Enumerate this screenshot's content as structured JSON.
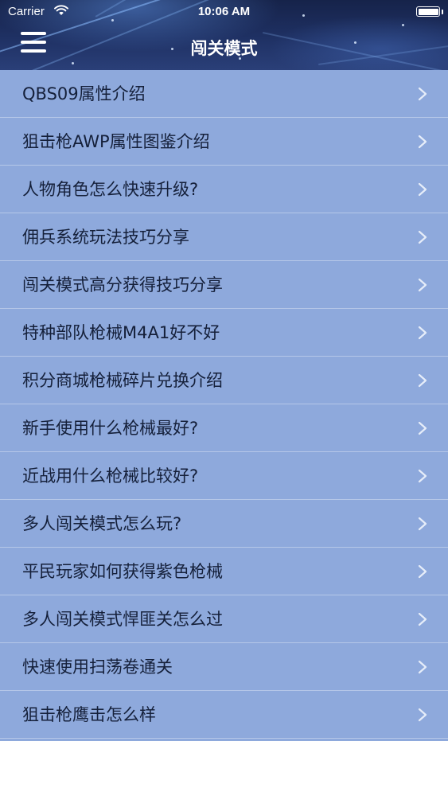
{
  "status_bar": {
    "carrier": "Carrier",
    "time": "10:06 AM"
  },
  "nav": {
    "title": "闯关模式",
    "menu_icon": "hamburger-menu-icon"
  },
  "list": {
    "items": [
      {
        "label": "QBS09属性介绍"
      },
      {
        "label": "狙击枪AWP属性图鉴介绍"
      },
      {
        "label": "人物角色怎么快速升级?"
      },
      {
        "label": "佣兵系统玩法技巧分享"
      },
      {
        "label": "闯关模式高分获得技巧分享"
      },
      {
        "label": "特种部队枪械M4A1好不好"
      },
      {
        "label": "积分商城枪械碎片兑换介绍"
      },
      {
        "label": "新手使用什么枪械最好?"
      },
      {
        "label": "近战用什么枪械比较好?"
      },
      {
        "label": "多人闯关模式怎么玩?"
      },
      {
        "label": "平民玩家如何获得紫色枪械"
      },
      {
        "label": "多人闯关模式悍匪关怎么过"
      },
      {
        "label": "快速使用扫荡卷通关"
      },
      {
        "label": "狙击枪鹰击怎么样"
      }
    ],
    "row_icon": "chevron-right-icon"
  },
  "colors": {
    "list_background": "#8ea9dc",
    "header_background": "#1f3164",
    "text": "#15203a"
  }
}
